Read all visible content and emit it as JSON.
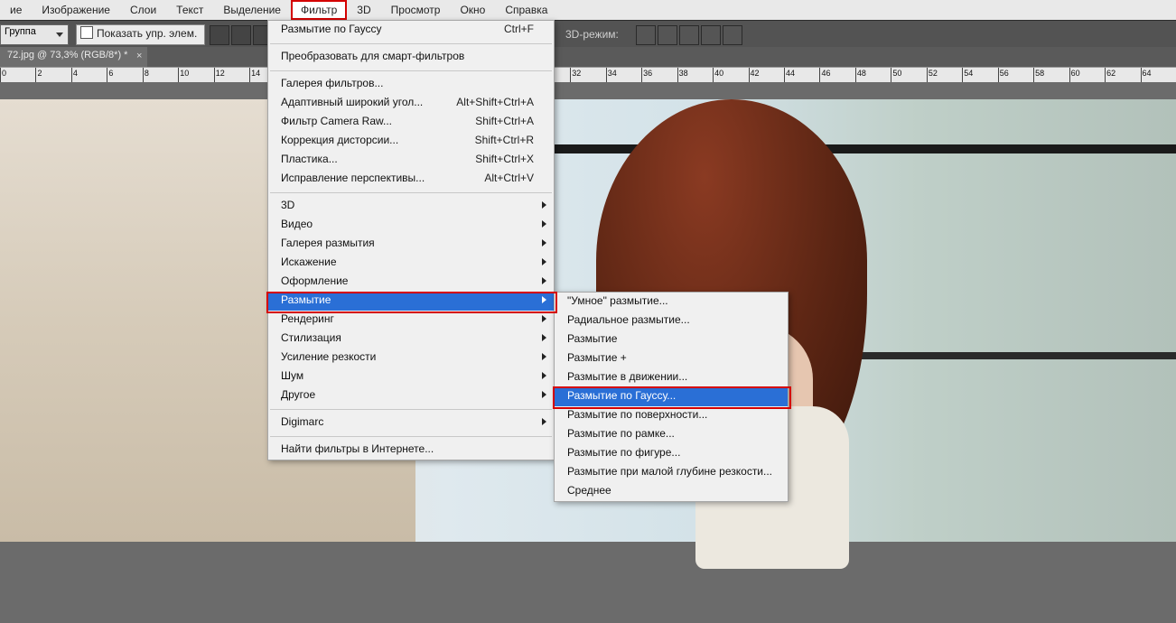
{
  "menubar": {
    "items": [
      "ие",
      "Изображение",
      "Слои",
      "Текст",
      "Выделение",
      "Фильтр",
      "3D",
      "Просмотр",
      "Окно",
      "Справка"
    ],
    "active_index": 5
  },
  "toolbar": {
    "group_select": "Группа",
    "show_controls": "Показать упр. элем.",
    "mode_label": "3D-режим:"
  },
  "tab": {
    "title": "72.jpg @ 73,3% (RGB/8*) *"
  },
  "ruler": {
    "start": 0,
    "end": 66,
    "step": 2
  },
  "filter_menu": {
    "top": {
      "label": "Размытие по Гауссу",
      "shortcut": "Ctrl+F"
    },
    "smart": "Преобразовать для смарт-фильтров",
    "group1": [
      {
        "label": "Галерея фильтров..."
      },
      {
        "label": "Адаптивный широкий угол...",
        "shortcut": "Alt+Shift+Ctrl+A"
      },
      {
        "label": "Фильтр Camera Raw...",
        "shortcut": "Shift+Ctrl+A"
      },
      {
        "label": "Коррекция дисторсии...",
        "shortcut": "Shift+Ctrl+R"
      },
      {
        "label": "Пластика...",
        "shortcut": "Shift+Ctrl+X"
      },
      {
        "label": "Исправление перспективы...",
        "shortcut": "Alt+Ctrl+V"
      }
    ],
    "group2": [
      {
        "label": "3D",
        "sub": true
      },
      {
        "label": "Видео",
        "sub": true
      },
      {
        "label": "Галерея размытия",
        "sub": true
      },
      {
        "label": "Искажение",
        "sub": true
      },
      {
        "label": "Оформление",
        "sub": true
      },
      {
        "label": "Размытие",
        "sub": true,
        "selected": true
      },
      {
        "label": "Рендеринг",
        "sub": true
      },
      {
        "label": "Стилизация",
        "sub": true
      },
      {
        "label": "Усиление резкости",
        "sub": true
      },
      {
        "label": "Шум",
        "sub": true
      },
      {
        "label": "Другое",
        "sub": true
      }
    ],
    "digimarc": {
      "label": "Digimarc",
      "sub": true
    },
    "online": "Найти фильтры в Интернете..."
  },
  "blur_submenu": {
    "items": [
      "\"Умное\" размытие...",
      "Радиальное размытие...",
      "Размытие",
      "Размытие +",
      "Размытие в движении...",
      "Размытие по Гауссу...",
      "Размытие по поверхности...",
      "Размытие по рамке...",
      "Размытие по фигуре...",
      "Размытие при малой глубине резкости...",
      "Среднее"
    ],
    "selected_index": 5
  }
}
